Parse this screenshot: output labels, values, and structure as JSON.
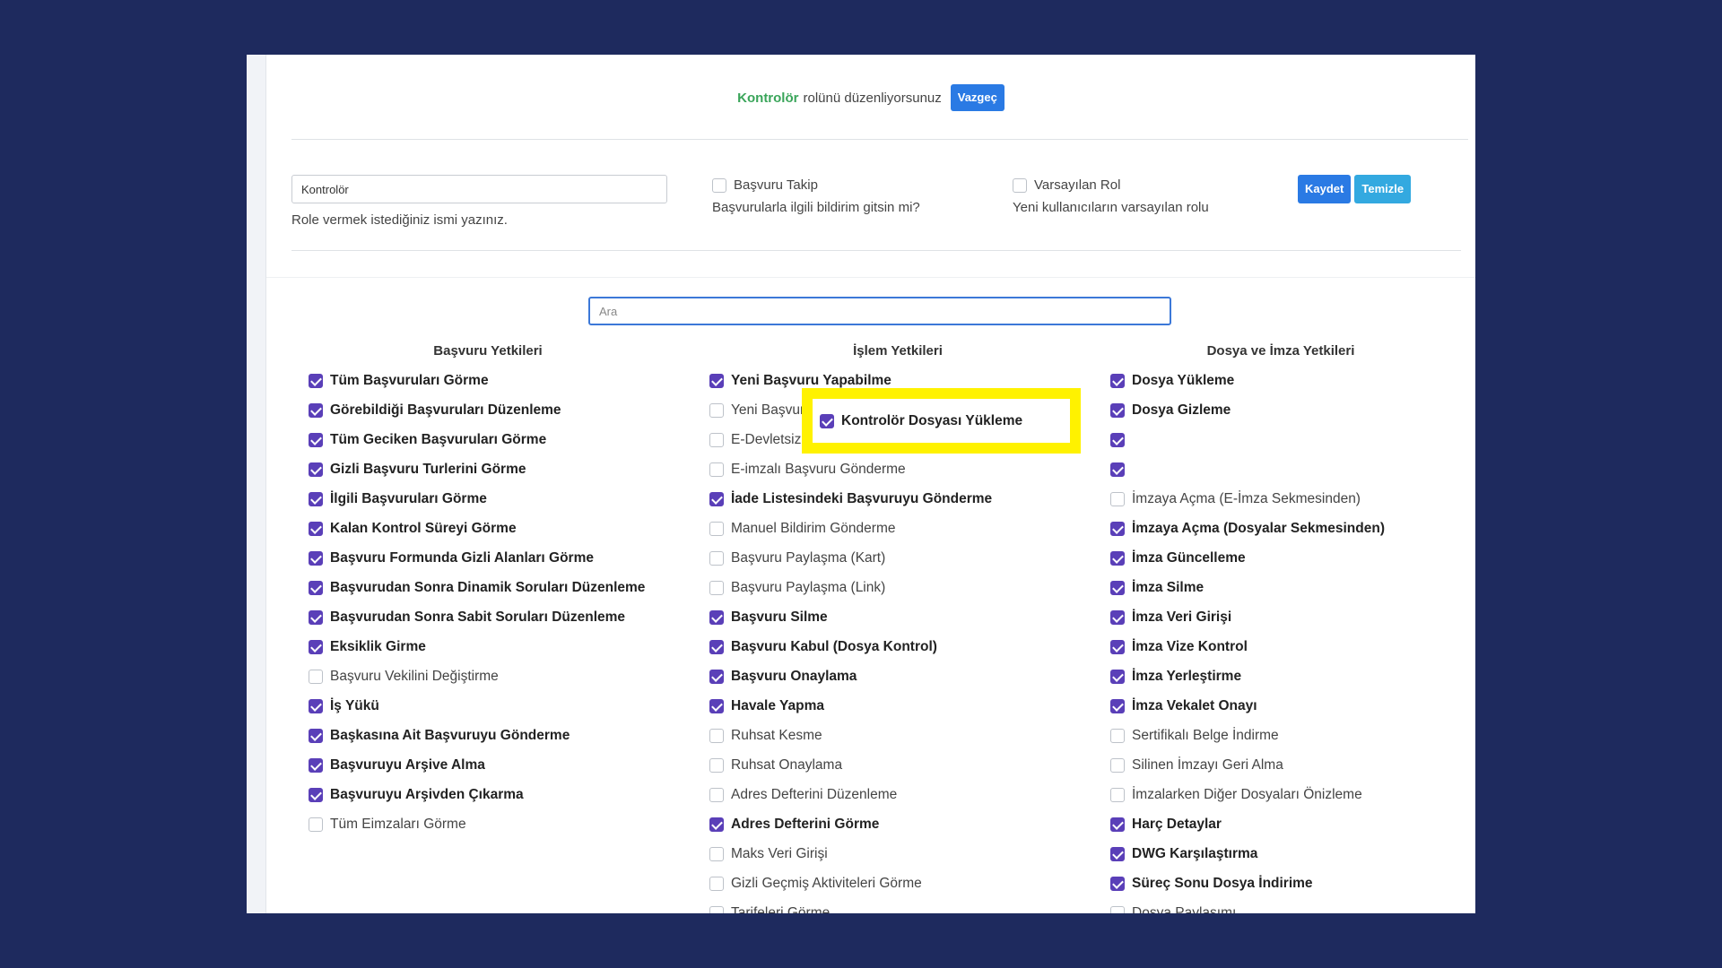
{
  "header": {
    "role_name": "Kontrolör",
    "editing_text": "rolünü düzenliyorsunuz",
    "cancel_label": "Vazgeç"
  },
  "form": {
    "name_value": "Kontrolör",
    "name_help": "Role vermek istediğiniz ismi yazınız.",
    "takip_label": "Başvuru Takip",
    "takip_checked": false,
    "takip_help": "Başvurularla ilgili bildirim gitsin mi?",
    "default_label": "Varsayılan Rol",
    "default_checked": false,
    "default_help": "Yeni kullanıcıların varsayılan rolu",
    "save_label": "Kaydet",
    "clear_label": "Temizle"
  },
  "search": {
    "placeholder": "Ara"
  },
  "columns": [
    {
      "title": "Başvuru Yetkileri",
      "items": [
        {
          "label": "Tüm Başvuruları Görme",
          "checked": true
        },
        {
          "label": "Görebildiği Başvuruları Düzenleme",
          "checked": true
        },
        {
          "label": "Tüm Geciken Başvuruları Görme",
          "checked": true
        },
        {
          "label": "Gizli Başvuru Turlerini Görme",
          "checked": true
        },
        {
          "label": "İlgili Başvuruları Görme",
          "checked": true
        },
        {
          "label": "Kalan Kontrol Süreyi Görme",
          "checked": true
        },
        {
          "label": "Başvuru Formunda Gizli Alanları Görme",
          "checked": true
        },
        {
          "label": "Başvurudan Sonra Dinamik Soruları Düzenleme",
          "checked": true
        },
        {
          "label": "Başvurudan Sonra Sabit Soruları Düzenleme",
          "checked": true
        },
        {
          "label": "Eksiklik Girme",
          "checked": true
        },
        {
          "label": "Başvuru Vekilini Değiştirme",
          "checked": false
        },
        {
          "label": "İş Yükü",
          "checked": true
        },
        {
          "label": "Başkasına Ait Başvuruyu Gönderme",
          "checked": true
        },
        {
          "label": "Başvuruyu Arşive Alma",
          "checked": true
        },
        {
          "label": "Başvuruyu Arşivden Çıkarma",
          "checked": true
        },
        {
          "label": "Tüm Eimzaları Görme",
          "checked": false
        }
      ]
    },
    {
      "title": "İşlem Yetkileri",
      "items": [
        {
          "label": "Yeni Başvuru Yapabilme",
          "checked": true
        },
        {
          "label": "Yeni Başvuruda Zorunlu Alanları Boş Bırakabilme",
          "checked": false
        },
        {
          "label": "E-Devletsiz Başvuru Yapabilme",
          "checked": false
        },
        {
          "label": "E-imzalı Başvuru Gönderme",
          "checked": false
        },
        {
          "label": "İade Listesindeki Başvuruyu Gönderme",
          "checked": true
        },
        {
          "label": "Manuel Bildirim Gönderme",
          "checked": false
        },
        {
          "label": "Başvuru Paylaşma (Kart)",
          "checked": false
        },
        {
          "label": "Başvuru Paylaşma (Link)",
          "checked": false
        },
        {
          "label": "Başvuru Silme",
          "checked": true
        },
        {
          "label": "Başvuru Kabul (Dosya Kontrol)",
          "checked": true
        },
        {
          "label": "Başvuru Onaylama",
          "checked": true
        },
        {
          "label": "Havale Yapma",
          "checked": true
        },
        {
          "label": "Ruhsat Kesme",
          "checked": false
        },
        {
          "label": "Ruhsat Onaylama",
          "checked": false
        },
        {
          "label": "Adres Defterini Düzenleme",
          "checked": false
        },
        {
          "label": "Adres Defterini Görme",
          "checked": true
        },
        {
          "label": "Maks Veri Girişi",
          "checked": false
        },
        {
          "label": "Gizli Geçmiş Aktiviteleri Görme",
          "checked": false
        },
        {
          "label": "Tarifeleri Görme",
          "checked": false
        }
      ]
    },
    {
      "title": "Dosya ve İmza Yetkileri",
      "items": [
        {
          "label": "Dosya Yükleme",
          "checked": true
        },
        {
          "label": "Dosya Gizleme",
          "checked": true
        },
        {
          "label": "",
          "checked": true
        },
        {
          "label": "",
          "checked": true
        },
        {
          "label": "İmzaya Açma (E-İmza Sekmesinden)",
          "checked": false
        },
        {
          "label": "İmzaya Açma (Dosyalar Sekmesinden)",
          "checked": true
        },
        {
          "label": "İmza Güncelleme",
          "checked": true
        },
        {
          "label": "İmza Silme",
          "checked": true
        },
        {
          "label": "İmza Veri Girişi",
          "checked": true
        },
        {
          "label": "İmza Vize Kontrol",
          "checked": true
        },
        {
          "label": "İmza Yerleştirme",
          "checked": true
        },
        {
          "label": "İmza Vekalet Onayı",
          "checked": true
        },
        {
          "label": "Sertifikalı Belge İndirme",
          "checked": false
        },
        {
          "label": "Silinen İmzayı Geri Alma",
          "checked": false
        },
        {
          "label": "İmzalarken Diğer Dosyaları Önizleme",
          "checked": false
        },
        {
          "label": "Harç Detaylar",
          "checked": true
        },
        {
          "label": "DWG Karşılaştırma",
          "checked": true
        },
        {
          "label": "Süreç Sonu Dosya İndirime",
          "checked": true
        },
        {
          "label": "Dosya Paylaşımı",
          "checked": false
        }
      ]
    }
  ],
  "highlight": {
    "label": "Kontrolör Dosyası Yükleme",
    "checked": true,
    "color": "#fff200"
  }
}
